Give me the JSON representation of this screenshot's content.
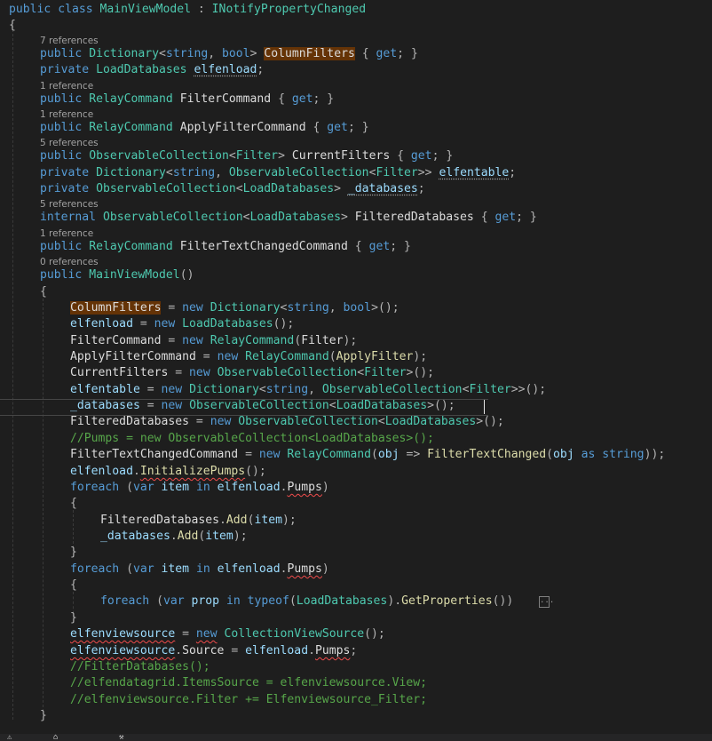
{
  "codelens": {
    "cl1": "7 references",
    "cl2": "1 reference",
    "cl3": "1 reference",
    "cl4": "5 references",
    "cl5": "5 references",
    "cl6": "1 reference",
    "cl7": "0 references"
  },
  "code": {
    "l1": [
      "public",
      "class",
      "MainViewModel",
      ":",
      "INotifyPropertyChanged"
    ],
    "l2": "{",
    "l3": [
      "public",
      "Dictionary",
      "<",
      "string",
      ",",
      "bool",
      ">",
      "ColumnFilters",
      "{",
      "get",
      ";",
      "}"
    ],
    "l4": [
      "private",
      "LoadDatabases",
      "elfenload",
      ";"
    ],
    "l5": [
      "public",
      "RelayCommand",
      "FilterCommand",
      "{",
      "get",
      ";",
      "}"
    ],
    "l6": [
      "public",
      "RelayCommand",
      "ApplyFilterCommand",
      "{",
      "get",
      ";",
      "}"
    ],
    "l7": [
      "public",
      "ObservableCollection",
      "<",
      "Filter",
      ">",
      "CurrentFilters",
      "{",
      "get",
      ";",
      "}"
    ],
    "l8": [
      "private",
      "Dictionary",
      "<",
      "string",
      ",",
      "ObservableCollection",
      "<",
      "Filter",
      ">>",
      "elfentable",
      ";"
    ],
    "l9": [
      "private",
      "ObservableCollection",
      "<",
      "LoadDatabases",
      ">",
      "_databases",
      ";"
    ],
    "l10": [
      "internal",
      "ObservableCollection",
      "<",
      "LoadDatabases",
      ">",
      "FilteredDatabases",
      "{",
      "get",
      ";",
      "}"
    ],
    "l11": [
      "public",
      "RelayCommand",
      "FilterTextChangedCommand",
      "{",
      "get",
      ";",
      "}"
    ],
    "l12": [
      "public",
      "MainViewModel",
      "()"
    ],
    "l13": "{",
    "l14": [
      "ColumnFilters",
      "=",
      "new",
      "Dictionary",
      "<",
      "string",
      ",",
      "bool",
      ">();"
    ],
    "l15": [
      "elfenload",
      "=",
      "new",
      "LoadDatabases",
      "();"
    ],
    "l16": [
      "FilterCommand",
      "=",
      "new",
      "RelayCommand",
      "(",
      "Filter",
      ");"
    ],
    "l17": [
      "ApplyFilterCommand",
      "=",
      "new",
      "RelayCommand",
      "(",
      "ApplyFilter",
      ");"
    ],
    "l18": [
      "CurrentFilters",
      "=",
      "new",
      "ObservableCollection",
      "<",
      "Filter",
      ">();"
    ],
    "l19": [
      "elfentable",
      "=",
      "new",
      "Dictionary",
      "<",
      "string",
      ",",
      "ObservableCollection",
      "<",
      "Filter",
      ">>();"
    ],
    "l20": [
      "_databases",
      "=",
      "new",
      "ObservableCollection",
      "<",
      "LoadDatabases",
      ">();"
    ],
    "l21": [
      "FilteredDatabases",
      "=",
      "new",
      "ObservableCollection",
      "<",
      "LoadDatabases",
      ">();"
    ],
    "l22": "//Pumps = new ObservableCollection<LoadDatabases>();",
    "l23": [
      "FilterTextChangedCommand",
      "=",
      "new",
      "RelayCommand",
      "(",
      "obj",
      "=>",
      "FilterTextChanged",
      "(",
      "obj",
      "as",
      "string",
      "));"
    ],
    "l24": [
      "elfenload",
      ".",
      "InitializePumps",
      "();"
    ],
    "l25": [
      "foreach",
      "(",
      "var",
      "item",
      "in",
      "elfenload",
      ".",
      "Pumps",
      ")"
    ],
    "l26": "{",
    "l27": [
      "FilteredDatabases",
      ".",
      "Add",
      "(",
      "item",
      ");"
    ],
    "l28": [
      "_databases",
      ".",
      "Add",
      "(",
      "item",
      ");"
    ],
    "l29": "}",
    "l30": [
      "foreach",
      "(",
      "var",
      "item",
      "in",
      "elfenload",
      ".",
      "Pumps",
      ")"
    ],
    "l31": "{",
    "l32": [
      "foreach",
      "(",
      "var",
      "prop",
      "in",
      "typeof",
      "(",
      "LoadDatabases",
      ").",
      "GetProperties",
      "())"
    ],
    "l33": "}",
    "l34": [
      "elfenviewsource",
      "=",
      "new",
      "CollectionViewSource",
      "();"
    ],
    "l35": [
      "elfenviewsource",
      ".",
      "Source",
      "=",
      "elfenload",
      ".",
      "Pumps",
      ";"
    ],
    "l36": "//FilterDatabases();",
    "l37": "//elfendatagrid.ItemsSource = elfenviewsource.View;",
    "l38": "//elfenviewsource.Filter += Elfenviewsource_Filter;",
    "l39": "}"
  },
  "folded_marker": "...",
  "status_icons": [
    "warning-icon",
    "home-icon",
    "tools-icon"
  ],
  "colors": {
    "background": "#1e1e1e",
    "keyword": "#569cd6",
    "type": "#4ec9b0",
    "method": "#dcdcaa",
    "variable": "#9cdcfe",
    "comment": "#57a64a",
    "highlight": "#653306"
  }
}
